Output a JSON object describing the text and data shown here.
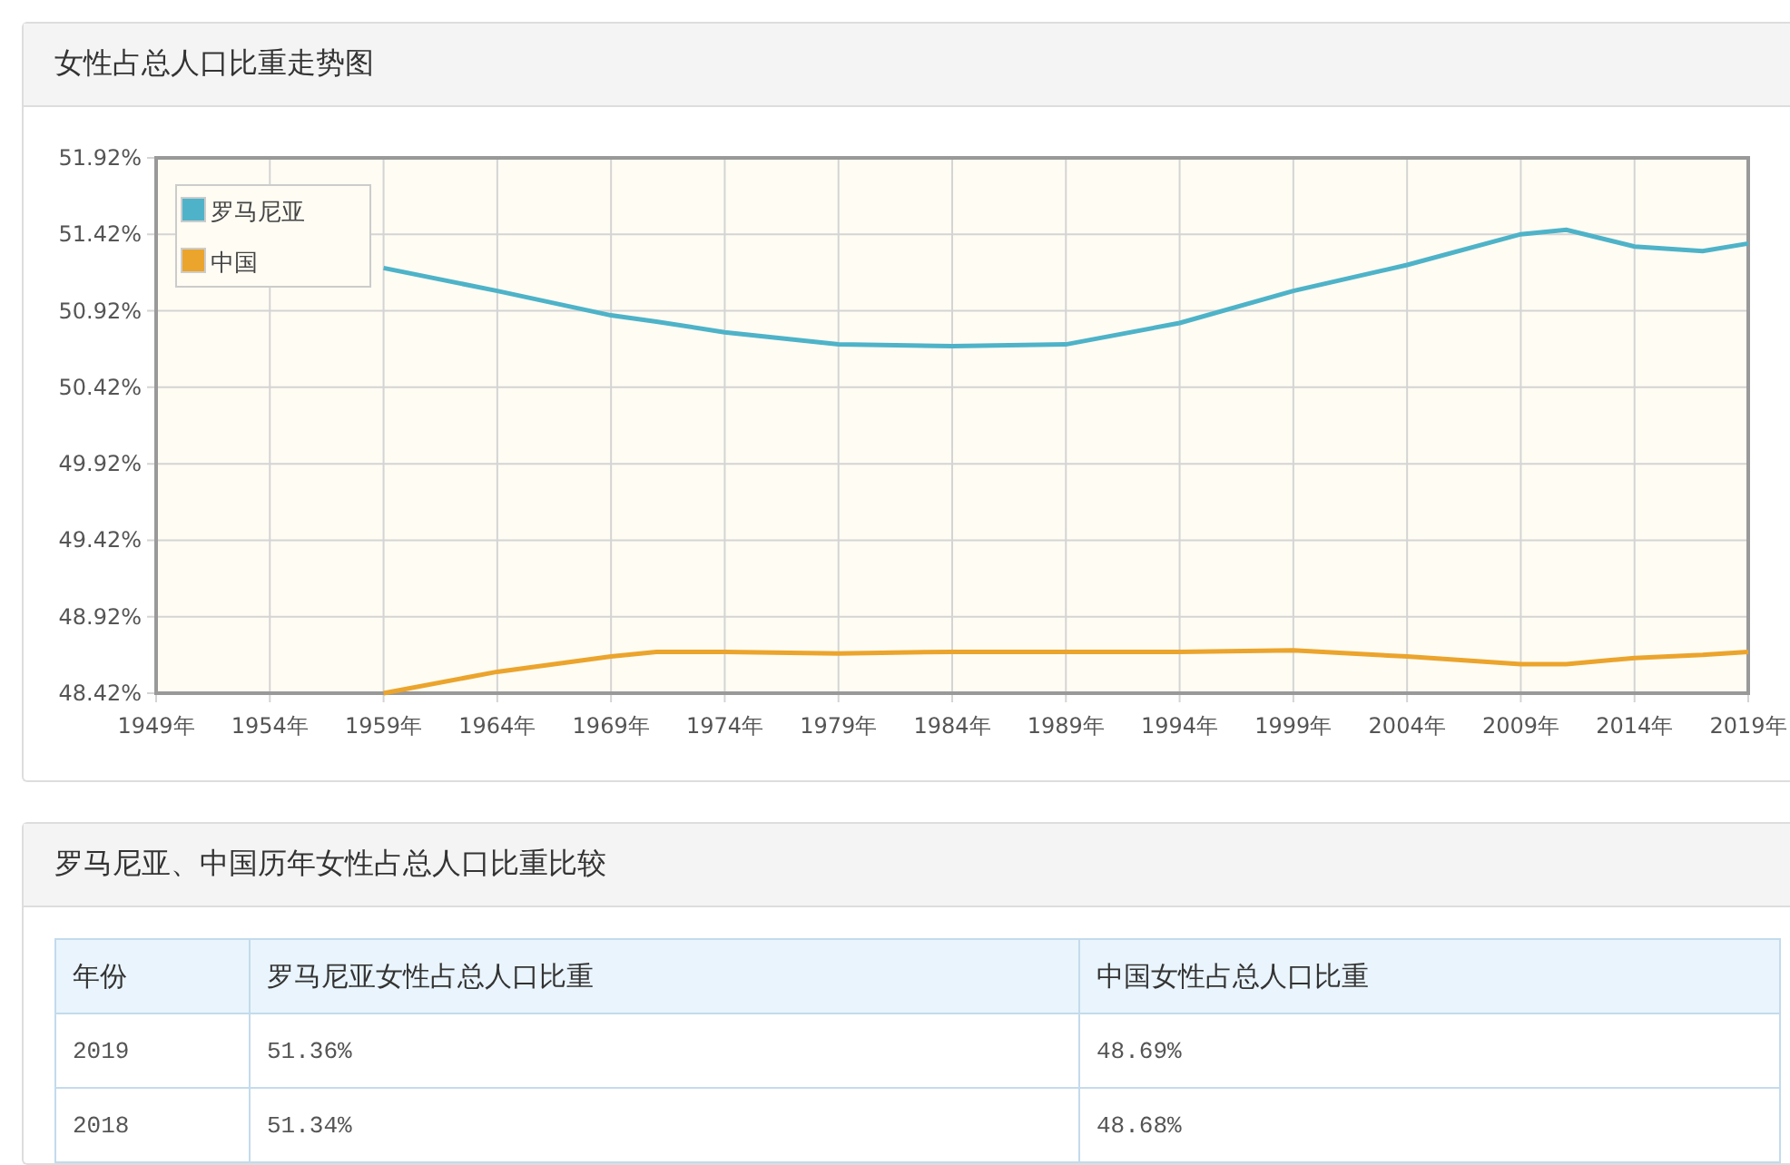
{
  "chart_panel": {
    "title": "女性占总人口比重走势图",
    "chart_data": {
      "type": "line",
      "x": [
        1959,
        1964,
        1969,
        1971,
        1974,
        1979,
        1984,
        1989,
        1994,
        1999,
        2004,
        2009,
        2011,
        2014,
        2017,
        2019
      ],
      "series": [
        {
          "name": "罗马尼亚",
          "color": "#4eb3c8",
          "values": [
            51.2,
            51.05,
            50.89,
            50.85,
            50.78,
            50.7,
            50.69,
            50.7,
            50.84,
            51.05,
            51.22,
            51.42,
            51.45,
            51.34,
            51.31,
            51.36
          ]
        },
        {
          "name": "中国",
          "color": "#eba42c",
          "values": [
            48.42,
            48.56,
            48.66,
            48.69,
            48.69,
            48.68,
            48.69,
            48.69,
            48.69,
            48.7,
            48.66,
            48.61,
            48.61,
            48.65,
            48.67,
            48.69
          ]
        }
      ],
      "grid": true,
      "legend": true,
      "xlim": [
        1949,
        2019
      ],
      "ylim": [
        48.42,
        51.92
      ],
      "xticks": [
        {
          "value": 1949,
          "label": "1949年"
        },
        {
          "value": 1954,
          "label": "1954年"
        },
        {
          "value": 1959,
          "label": "1959年"
        },
        {
          "value": 1964,
          "label": "1964年"
        },
        {
          "value": 1969,
          "label": "1969年"
        },
        {
          "value": 1974,
          "label": "1974年"
        },
        {
          "value": 1979,
          "label": "1979年"
        },
        {
          "value": 1984,
          "label": "1984年"
        },
        {
          "value": 1989,
          "label": "1989年"
        },
        {
          "value": 1994,
          "label": "1994年"
        },
        {
          "value": 1999,
          "label": "1999年"
        },
        {
          "value": 2004,
          "label": "2004年"
        },
        {
          "value": 2009,
          "label": "2009年"
        },
        {
          "value": 2014,
          "label": "2014年"
        },
        {
          "value": 2019,
          "label": "2019年"
        }
      ],
      "yticks": [
        {
          "value": 48.42,
          "label": "48.42%"
        },
        {
          "value": 48.92,
          "label": "48.92%"
        },
        {
          "value": 49.42,
          "label": "49.42%"
        },
        {
          "value": 49.92,
          "label": "49.92%"
        },
        {
          "value": 50.42,
          "label": "50.42%"
        },
        {
          "value": 50.92,
          "label": "50.92%"
        },
        {
          "value": 51.42,
          "label": "51.42%"
        },
        {
          "value": 51.92,
          "label": "51.92%"
        }
      ]
    }
  },
  "table_panel": {
    "title": "罗马尼亚、中国历年女性占总人口比重比较",
    "table": {
      "columns": [
        "年份",
        "罗马尼亚女性占总人口比重",
        "中国女性占总人口比重"
      ],
      "rows": [
        [
          "2019",
          "51.36%",
          "48.69%"
        ],
        [
          "2018",
          "51.34%",
          "48.68%"
        ]
      ]
    }
  }
}
